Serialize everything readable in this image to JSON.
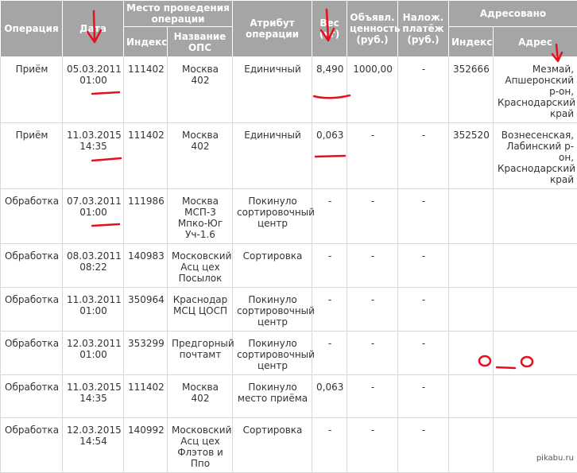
{
  "headers": {
    "operation": "Операция",
    "date": "Дата",
    "place": "Место проведения операции",
    "index": "Индекс",
    "ops_name": "Название ОПС",
    "attribute": "Атрибут операции",
    "weight": "Вес (кг)",
    "declared": "Объявл. ценность (руб.)",
    "cod": "Налож. платёж (руб.)",
    "addressed": "Адресовано",
    "addr_index": "Индекс",
    "address": "Адрес"
  },
  "rows": [
    {
      "op": "Приём",
      "date": "05.03.2011",
      "time": "01:00",
      "index": "111402",
      "ops": "Москва 402",
      "attr": "Единичный",
      "weight": "8,490",
      "declared": "1000,00",
      "cod": "-",
      "addr_index": "352666",
      "address": "Мезмай, Апшеронский р-он, Краснодарский край"
    },
    {
      "op": "Приём",
      "date": "11.03.2015",
      "time": "14:35",
      "index": "111402",
      "ops": "Москва 402",
      "attr": "Единичный",
      "weight": "0,063",
      "declared": "-",
      "cod": "-",
      "addr_index": "352520",
      "address": "Вознесенская, Лабинский р-он, Краснодарский край"
    },
    {
      "op": "Обработка",
      "date": "07.03.2011",
      "time": "01:00",
      "index": "111986",
      "ops": "Москва МСП-3 Мпко-Юг Уч-1.6",
      "attr": "Покинуло сортировочный центр",
      "weight": "-",
      "declared": "-",
      "cod": "-",
      "addr_index": "",
      "address": ""
    },
    {
      "op": "Обработка",
      "date": "08.03.2011",
      "time": "08:22",
      "index": "140983",
      "ops": "Московский Асц цех Посылок",
      "attr": "Сортировка",
      "weight": "-",
      "declared": "-",
      "cod": "-",
      "addr_index": "",
      "address": ""
    },
    {
      "op": "Обработка",
      "date": "11.03.2011",
      "time": "01:00",
      "index": "350964",
      "ops": "Краснодар МСЦ ЦОСП",
      "attr": "Покинуло сортировочный центр",
      "weight": "-",
      "declared": "-",
      "cod": "-",
      "addr_index": "",
      "address": ""
    },
    {
      "op": "Обработка",
      "date": "12.03.2011",
      "time": "01:00",
      "index": "353299",
      "ops": "Предгорный почтамт",
      "attr": "Покинуло сортировочный центр",
      "weight": "-",
      "declared": "-",
      "cod": "-",
      "addr_index": "",
      "address": ""
    },
    {
      "op": "Обработка",
      "date": "11.03.2015",
      "time": "14:35",
      "index": "111402",
      "ops": "Москва 402",
      "attr": "Покинуло место приёма",
      "weight": "0,063",
      "declared": "-",
      "cod": "-",
      "addr_index": "",
      "address": ""
    },
    {
      "op": "Обработка",
      "date": "12.03.2015",
      "time": "14:54",
      "index": "140992",
      "ops": "Московский Асц цех Флэтов и Ппо",
      "attr": "Сортировка",
      "weight": "-",
      "declared": "-",
      "cod": "-",
      "addr_index": "",
      "address": ""
    }
  ],
  "face_text": "o_o",
  "watermark": "pikabu.ru",
  "colors": {
    "header_bg": "#a5a5a5",
    "header_text": "#ffffff",
    "annotation": "#e8101e"
  }
}
